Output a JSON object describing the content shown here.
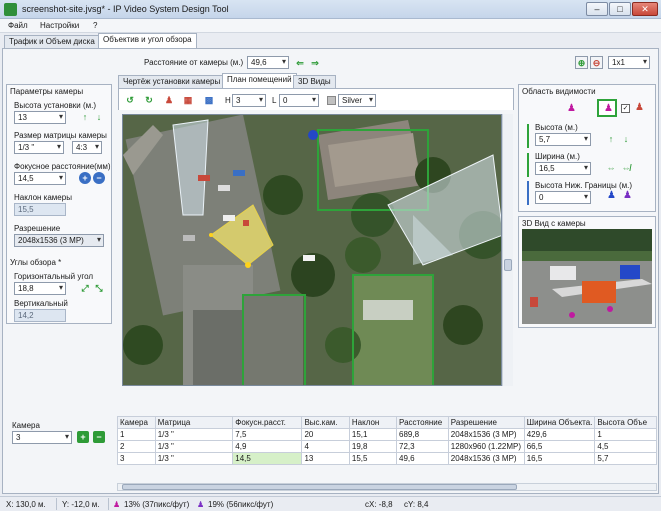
{
  "window": {
    "title": "screenshot-site.jvsg* - IP Video System Design Tool",
    "min": "–",
    "max": "□",
    "close": "✕"
  },
  "menu": [
    "Файл",
    "Настройки",
    "?"
  ],
  "main_tabs": [
    "Трафик и Объем диска",
    "Объектив и угол обзора"
  ],
  "toolbar": {
    "distance_label": "Расстояние от камеры (м.)",
    "distance_value": "49,6",
    "zoom_value": "1x1"
  },
  "camera_params": {
    "group_title": "Параметры камеры",
    "height_label": "Высота установки (м.)",
    "height_value": "13",
    "sensor_label": "Размер матрицы камеры",
    "sensor_value": "1/3 \"",
    "aspect_value": "4:3",
    "focal_label": "Фокусное расстояние(мм)",
    "focal_value": "14,5",
    "tilt_label": "Наклон камеры",
    "tilt_value": "15,5",
    "resolution_label": "Разрешение",
    "resolution_value": "2048x1536 (3 MP)"
  },
  "view_angles": {
    "group_title": "Углы обзора *",
    "horizontal_label": "Горизонтальный угол",
    "horizontal_value": "18,8",
    "vertical_label": "Вертикальный",
    "vertical_value": "14,2"
  },
  "view_tabs": [
    "Чертёж установки камеры",
    "План помещений",
    "3D Виды"
  ],
  "plan_toolbar": {
    "h_label": "H",
    "h_value": "3",
    "l_label": "L",
    "l_value": "0",
    "color_value": "Silver"
  },
  "visibility": {
    "group_title": "Область видимости",
    "height_label": "Высота (м.)",
    "height_value": "5,7",
    "width_label": "Ширина (м.)",
    "width_value": "16,5",
    "lower_label": "Высота Ниж. Границы (м.)",
    "lower_value": "0"
  },
  "view3d_title": "3D Вид с камеры",
  "camera_select": {
    "label": "Камера",
    "value": "3",
    "add": "+",
    "remove": "−"
  },
  "table": {
    "headers": [
      "Камера",
      "Матрица",
      "Фокусн.расст.",
      "Выс.кам.",
      "Наклон",
      "Расстояние",
      "Разрешение",
      "Ширина Объекта.",
      "Высота Объе"
    ],
    "rows": [
      [
        "1",
        "1/3 \"",
        "7,5",
        "20",
        "15,1",
        "689,8",
        "2048x1536 (3 MP)",
        "429,6",
        "1"
      ],
      [
        "2",
        "1/3 \"",
        "4,9",
        "4",
        "19,8",
        "72,3",
        "1280x960 (1.22MP)",
        "66,5",
        "4,5"
      ],
      [
        "3",
        "1/3 \"",
        "14,5",
        "13",
        "15,5",
        "49,6",
        "2048x1536 (3 MP)",
        "16,5",
        "5,7"
      ]
    ]
  },
  "status": {
    "x": "X: 130,0 м.",
    "y": "Y: -12,0 м.",
    "density1": "13% (37пикс/фут)",
    "density2": "19% (56пикс/фут)",
    "cx": "cX: -8,8",
    "cy": "cY: 8,4"
  },
  "colors": {
    "accent_green": "#2e9b37",
    "fov_yellow": "#f2e36a",
    "map_dark": "#4a5a3c"
  }
}
